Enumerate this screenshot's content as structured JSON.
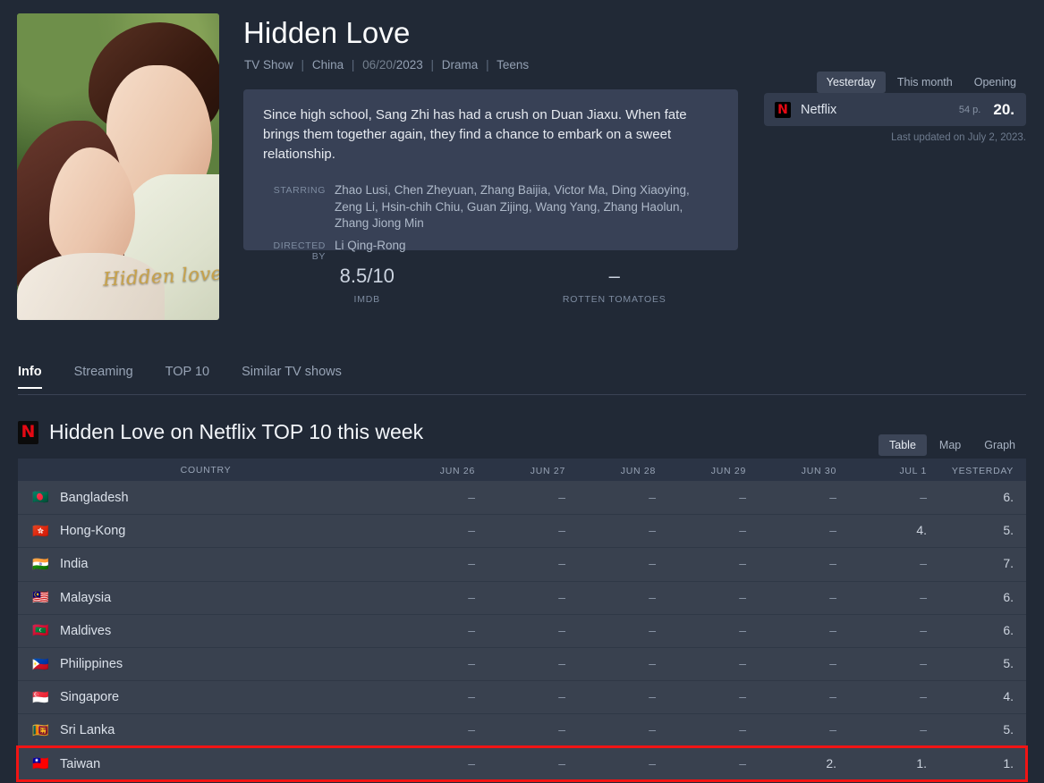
{
  "hero": {
    "title": "Hidden Love",
    "poster_script": "Hidden love",
    "meta": {
      "type": "TV Show",
      "country": "China",
      "date_prefix": "06/20/",
      "date_year": "2023",
      "genre": "Drama",
      "audience": "Teens",
      "separator": "|"
    },
    "synopsis": "Since high school, Sang Zhi has had a crush on Duan Jiaxu. When fate brings them together again, they find a chance to embark on a sweet relationship.",
    "credits": [
      {
        "label": "STARRING",
        "value": "Zhao Lusi, Chen Zheyuan, Zhang Baijia, Victor Ma, Ding Xiaoying, Zeng Li, Hsin-chih Chiu, Guan Zijing, Wang Yang, Zhang Haolun, Zhang Jiong Min"
      },
      {
        "label": "DIRECTED BY",
        "value": "Li Qing-Rong"
      }
    ],
    "ratings": [
      {
        "value": "8.5/10",
        "label": "IMDB"
      },
      {
        "value": "–",
        "label": "ROTTEN TOMATOES"
      }
    ]
  },
  "rank_panel": {
    "range_tabs": [
      {
        "label": "Yesterday",
        "active": true
      },
      {
        "label": "This month",
        "active": false
      },
      {
        "label": "Opening",
        "active": false
      }
    ],
    "platform": "Netflix",
    "platform_badge_letter": "N",
    "points": "54 p.",
    "position": "20.",
    "updated": "Last updated on July 2, 2023."
  },
  "tabs": [
    {
      "label": "Info",
      "active": true
    },
    {
      "label": "Streaming",
      "active": false
    },
    {
      "label": "TOP 10",
      "active": false
    },
    {
      "label": "Similar TV shows",
      "active": false
    }
  ],
  "section": {
    "badge_letter": "N",
    "title": "Hidden Love on Netflix TOP 10 this week",
    "view_tabs": [
      {
        "label": "Table",
        "active": true
      },
      {
        "label": "Map",
        "active": false
      },
      {
        "label": "Graph",
        "active": false
      }
    ]
  },
  "colors": {
    "page_bg": "#212936",
    "panel_bg": "#384156",
    "table_row_bg": "#39414f",
    "table_head_bg": "#2b3445",
    "netflix_red": "#e50914",
    "highlight_red": "#f11414",
    "accent_tab_bg": "#3c4557"
  },
  "table": {
    "columns": [
      "COUNTRY",
      "JUN 26",
      "JUN 27",
      "JUN 28",
      "JUN 29",
      "JUN 30",
      "JUL 1",
      "YESTERDAY"
    ],
    "rows": [
      {
        "flag": "🇧🇩",
        "country": "Bangladesh",
        "values": [
          "–",
          "–",
          "–",
          "–",
          "–",
          "–",
          "6."
        ],
        "highlighted": false
      },
      {
        "flag": "🇭🇰",
        "country": "Hong-Kong",
        "values": [
          "–",
          "–",
          "–",
          "–",
          "–",
          "4.",
          "5."
        ],
        "highlighted": false
      },
      {
        "flag": "🇮🇳",
        "country": "India",
        "values": [
          "–",
          "–",
          "–",
          "–",
          "–",
          "–",
          "7."
        ],
        "highlighted": false
      },
      {
        "flag": "🇲🇾",
        "country": "Malaysia",
        "values": [
          "–",
          "–",
          "–",
          "–",
          "–",
          "–",
          "6."
        ],
        "highlighted": false
      },
      {
        "flag": "🇲🇻",
        "country": "Maldives",
        "values": [
          "–",
          "–",
          "–",
          "–",
          "–",
          "–",
          "6."
        ],
        "highlighted": false
      },
      {
        "flag": "🇵🇭",
        "country": "Philippines",
        "values": [
          "–",
          "–",
          "–",
          "–",
          "–",
          "–",
          "5."
        ],
        "highlighted": false
      },
      {
        "flag": "🇸🇬",
        "country": "Singapore",
        "values": [
          "–",
          "–",
          "–",
          "–",
          "–",
          "–",
          "4."
        ],
        "highlighted": false
      },
      {
        "flag": "🇱🇰",
        "country": "Sri Lanka",
        "values": [
          "–",
          "–",
          "–",
          "–",
          "–",
          "–",
          "5."
        ],
        "highlighted": false
      },
      {
        "flag": "🇹🇼",
        "country": "Taiwan",
        "values": [
          "–",
          "–",
          "–",
          "–",
          "2.",
          "1.",
          "1."
        ],
        "highlighted": true
      }
    ]
  }
}
